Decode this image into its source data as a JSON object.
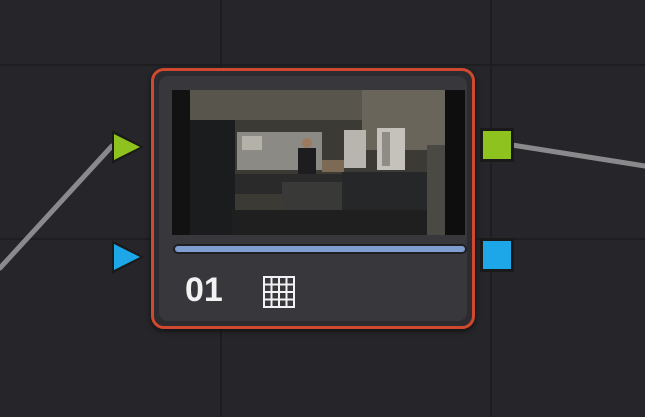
{
  "node": {
    "number_label": "01",
    "progress_fraction": 1.0,
    "border_color": "#d0492f",
    "progress_color": "#7f9fd0",
    "icon": "grid-icon"
  },
  "ports": {
    "rgb_input_color": "#8dc21f",
    "alpha_input_color": "#1ea7e8",
    "rgb_output_color": "#8dc21f",
    "alpha_output_color": "#1ea7e8"
  },
  "thumbnail": {
    "subject": "thumbnail-image"
  }
}
